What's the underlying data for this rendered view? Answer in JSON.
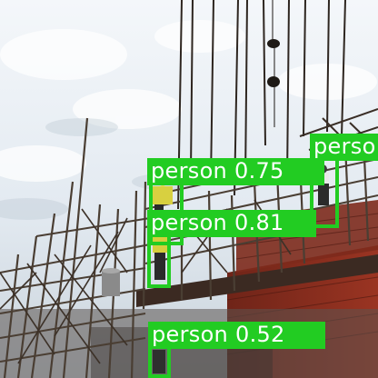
{
  "image": {
    "description_class": "construction scaffolding photo with object detections"
  },
  "detections": [
    {
      "class": "person",
      "confidence": "0.75",
      "label": "person 0.75"
    },
    {
      "class": "person",
      "confidence": "0.81",
      "label": "person 0.81"
    },
    {
      "class": "person",
      "confidence": "0.52",
      "label": "person 0.52"
    },
    {
      "class": "person",
      "confidence": "",
      "label": "perso"
    }
  ],
  "colors": {
    "box": "#22cc22",
    "label_text": "#ffffff",
    "sky": "#e9eff4",
    "scaffold": "#4a3e33",
    "brick": "#8a2a1c"
  }
}
